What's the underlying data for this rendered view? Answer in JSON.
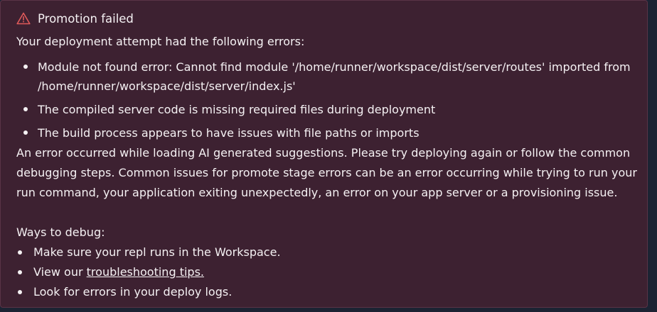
{
  "alert": {
    "icon": "warning-triangle-icon",
    "title": "Promotion failed",
    "accent_color": "#e05a5a",
    "background_color": "#3d2131"
  },
  "intro": "Your deployment attempt had the following errors:",
  "errors": [
    "Module not found error: Cannot find module '/home/runner/workspace/dist/server/routes' imported from /home/runner/workspace/dist/server/index.js'",
    "The compiled server code is missing required files during deployment",
    "The build process appears to have issues with file paths or imports"
  ],
  "summary": "An error occurred while loading AI generated suggestions. Please try deploying again or follow the common debugging steps. Common issues for promote stage errors can be an error occurring while trying to run your run command, your application exiting unexpectedly, an error on your app server or a provisioning issue.",
  "debug": {
    "heading": "Ways to debug:",
    "item1": "Make sure your repl runs in the Workspace.",
    "item2_prefix": "View our ",
    "item2_link": "troubleshooting tips.",
    "item3": "Look for errors in your deploy logs."
  }
}
